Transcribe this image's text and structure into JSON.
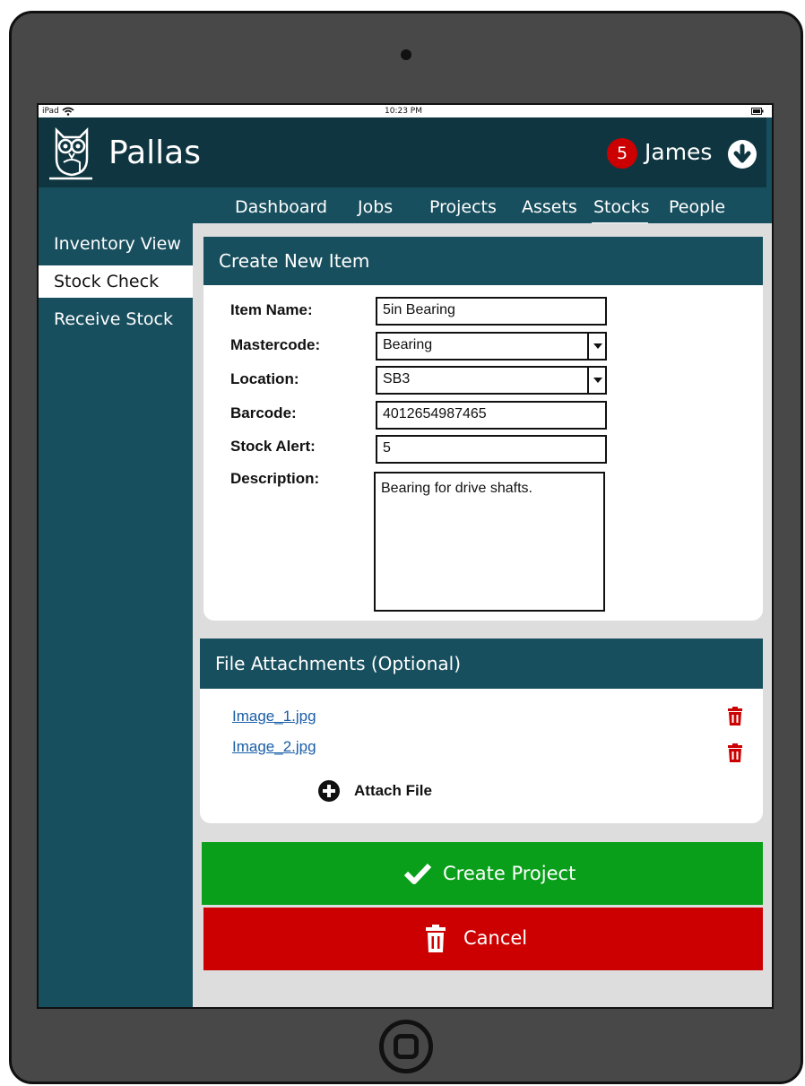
{
  "status_bar": {
    "device": "iPad",
    "time": "10:23 PM"
  },
  "app": {
    "name": "Pallas"
  },
  "user": {
    "name": "James",
    "notifications": "5"
  },
  "nav": [
    "Dashboard",
    "Jobs",
    "Projects",
    "Assets",
    "Stocks",
    "People"
  ],
  "nav_active": "Stocks",
  "sidebar": [
    "Inventory View",
    "Stock Check",
    "Receive Stock"
  ],
  "sidebar_active": "Stock Check",
  "form": {
    "title": "Create New Item",
    "item_name_label": "Item Name:",
    "item_name_value": "5in Bearing",
    "mastercode_label": "Mastercode:",
    "mastercode_value": "Bearing",
    "location_label": "Location:",
    "location_value": "SB3",
    "barcode_label": "Barcode:",
    "barcode_value": "4012654987465",
    "stock_alert_label": "Stock Alert:",
    "stock_alert_value": "5",
    "description_label": "Description:",
    "description_value": "Bearing for drive shafts."
  },
  "attachments": {
    "title": "File Attachments (Optional)",
    "files": [
      "Image_1.jpg",
      "Image_2.jpg"
    ],
    "attach_label": "Attach File"
  },
  "actions": {
    "create": "Create Project",
    "cancel": "Cancel"
  },
  "colors": {
    "header_dark": "#0f3640",
    "header_teal": "#184f5e",
    "create_green": "#0a9f1a",
    "cancel_red": "#cc0000",
    "delete_red": "#cc0000",
    "link_blue": "#1a5ea8"
  },
  "icons": [
    "owl-logo-icon",
    "wifi-icon",
    "battery-icon",
    "download-circle-icon",
    "trash-icon",
    "plus-circle-icon",
    "checkmark-icon",
    "home-button-icon"
  ]
}
